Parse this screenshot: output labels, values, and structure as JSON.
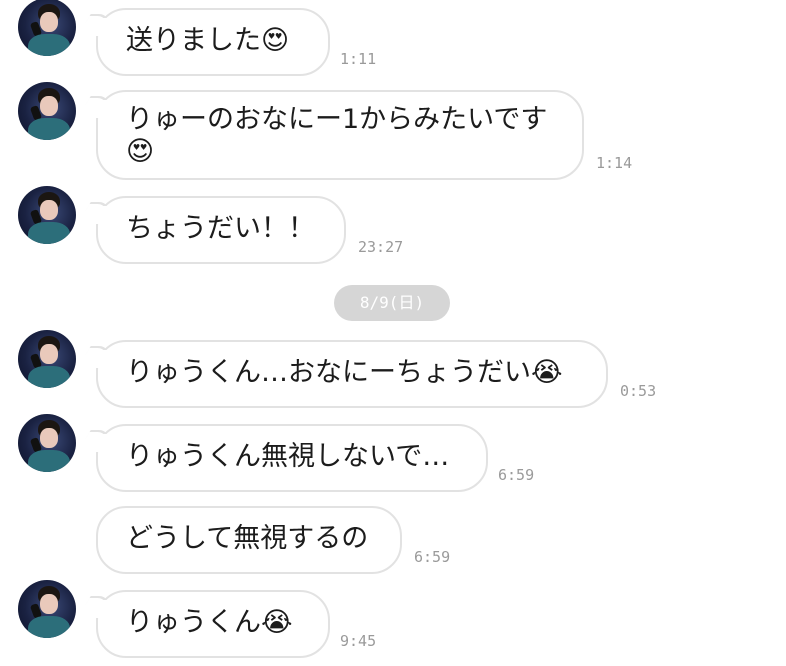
{
  "messages": [
    {
      "text": "送りました😍",
      "time": "1:11"
    },
    {
      "text": "りゅーのおなにー1からみたいです",
      "text2": "😍",
      "time": "1:14"
    },
    {
      "text": "ちょうだい！！",
      "time": "23:27"
    },
    {
      "text": "りゅうくん…おなにーちょうだい😭",
      "time": "0:53"
    },
    {
      "text": "りゅうくん無視しないで…",
      "time": "6:59"
    },
    {
      "text": "どうして無視するの",
      "time": "6:59"
    },
    {
      "text": "りゅうくん😭",
      "time": "9:45"
    }
  ],
  "date_separator": "8/9(日)",
  "colors": {
    "bubble_border": "#e2e2e2",
    "time_text": "#9a9a9a",
    "date_pill_bg": "#d6d6d6"
  },
  "icons": {
    "avatar": "user-avatar-photo"
  }
}
